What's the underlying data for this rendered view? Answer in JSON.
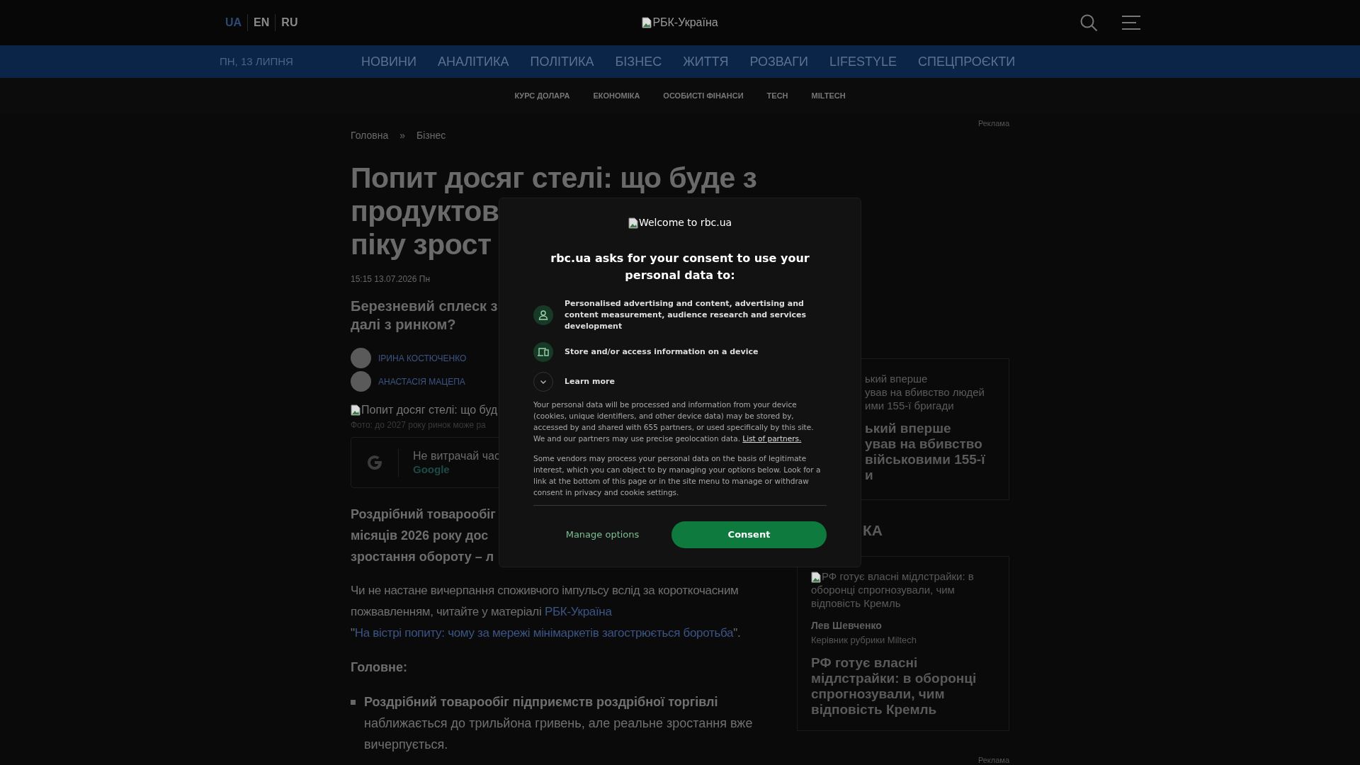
{
  "header": {
    "languages": [
      {
        "label": "UA",
        "selected": true
      },
      {
        "label": "EN",
        "selected": false
      },
      {
        "label": "RU",
        "selected": false
      }
    ],
    "logo_alt": "РБК-Україна"
  },
  "nav": {
    "date": "ПН, 13 ЛИПНЯ",
    "items": [
      "НОВИНИ",
      "АНАЛІТИКА",
      "ПОЛІТИКА",
      "БІЗНЕС",
      "ЖИТТЯ",
      "РОЗВАГИ",
      "LIFESTYLE",
      "СПЕЦПРОЄКТИ"
    ]
  },
  "subnav": [
    "КУРС ДОЛАРА",
    "ЕКОНОМІКА",
    "ОСОБИСТІ ФІНАНСИ",
    "TECH",
    "MILTECH"
  ],
  "ad_label_top": "Реклама",
  "breadcrumbs": [
    "Головна",
    "»",
    "Бізнес"
  ],
  "article": {
    "title_lines": [
      "Попит досяг стелі: що буде з",
      "продуктов",
      "піку зрост"
    ],
    "date": "15:15 13.07.2026 Пн",
    "lead_lines": [
      "Березневий сплеск з",
      "далі з ринком?"
    ],
    "authors": [
      "ІРИНА КОСТЮЧЕНКО",
      "АНАСТАСІЯ МАЦЕПА"
    ],
    "image_alt": "Попит досяг стелі: що буд",
    "caption": "Фото: до 2027 року ринок може ра",
    "google_card": {
      "text": "Не витрачай час",
      "link": "Google"
    },
    "bold_lines": [
      "Роздрібний товарообіг",
      "місяців 2026 року дос",
      "зростання обороту – л"
    ],
    "paragraph": {
      "text": "Чи не настане вичерпання споживчого імпульсу вслід за короткочасним пожвавленням, читайте у матеріалі",
      "source_link": "РБК-Україна",
      "quote_open": "\"",
      "article_link": "На вістрі попиту: чому за мережі мінімаркетів загострюється боротьба",
      "quote_close": "\"."
    },
    "summary_heading": "Головне:",
    "bullets": [
      "**Роздрібний товарообіг підприємств роздрібної торгівлі** наближається до трильйона гривень, але реальне зростання вже вичерпується."
    ]
  },
  "sidebar": {
    "card_partial": {
      "image_alt_lines": [
        "ький вперше",
        "ував на вбивство людей",
        "ими 155-ї бригади"
      ],
      "title_lines": [
        "ький вперше",
        "ував на вбивство",
        "військовими 155-ї",
        "и"
      ]
    },
    "section_heading": "КА",
    "card": {
      "image_alt": "РФ готує власні мідлстрайки: в оборонці спрогнозували, чим відповість Кремль",
      "author": "Лев Шевченко",
      "role": "Керівник рубрики Miltech",
      "title": "РФ готує власні мідлстрайки: в оборонці спрогнозували, чим відповість Кремль"
    },
    "ad_label_bottom": "Реклама"
  },
  "consent": {
    "logo_alt": "Welcome to rbc.ua",
    "heading": "rbc.ua asks for your consent to use your personal data to:",
    "purposes": [
      {
        "kind": "person",
        "text": "Personalised advertising and content, advertising and content measurement, audience research and services development"
      },
      {
        "kind": "device",
        "text": "Store and/or access information on a device"
      }
    ],
    "learn_more": {
      "label": "Learn more",
      "expanded": false
    },
    "paragraph_1": "Your personal data will be processed and information from your device (cookies, unique identifiers, and other device data) may be stored by, accessed by and shared with 655 partners, or used specifically by this site. We and our partners may use precise geolocation data.",
    "partners_link": "List of partners.",
    "paragraph_2": "Some vendors may process your personal data on the basis of legitimate interest, which you can object to by managing your options below. Look for a link at the bottom of this page or in the site menu to manage or withdraw consent in privacy and cookie settings.",
    "buttons": {
      "manage": "Manage options",
      "consent": "Consent"
    }
  }
}
